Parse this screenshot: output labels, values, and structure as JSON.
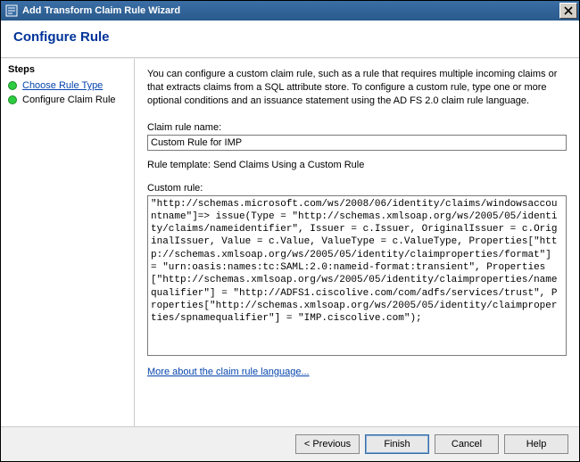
{
  "window": {
    "title": "Add Transform Claim Rule Wizard"
  },
  "header": {
    "title": "Configure Rule"
  },
  "sidebar": {
    "title": "Steps",
    "items": [
      {
        "label": "Choose Rule Type"
      },
      {
        "label": "Configure Claim Rule"
      }
    ]
  },
  "content": {
    "description": "You can configure a custom claim rule, such as a rule that requires multiple incoming claims or that extracts claims from a SQL attribute store. To configure a custom rule, type one or more optional conditions and an issuance statement using the AD FS 2.0 claim rule language.",
    "name_label": "Claim rule name:",
    "name_value": "Custom Rule for IMP",
    "template_label": "Rule template: Send Claims Using a Custom Rule",
    "custom_label": "Custom rule:",
    "custom_value": "\"http://schemas.microsoft.com/ws/2008/06/identity/claims/windowsaccountname\"]=> issue(Type = \"http://schemas.xmlsoap.org/ws/2005/05/identity/claims/nameidentifier\", Issuer = c.Issuer, OriginalIssuer = c.OriginalIssuer, Value = c.Value, ValueType = c.ValueType, Properties[\"http://schemas.xmlsoap.org/ws/2005/05/identity/claimproperties/format\"] = \"urn:oasis:names:tc:SAML:2.0:nameid-format:transient\", Properties[\"http://schemas.xmlsoap.org/ws/2005/05/identity/claimproperties/namequalifier\"] = \"http://ADFS1.ciscolive.com/com/adfs/services/trust\", Properties[\"http://schemas.xmlsoap.org/ws/2005/05/identity/claimproperties/spnamequalifier\"] = \"IMP.ciscolive.com\");",
    "link": "More about the claim rule language..."
  },
  "footer": {
    "previous": "< Previous",
    "finish": "Finish",
    "cancel": "Cancel",
    "help": "Help"
  }
}
